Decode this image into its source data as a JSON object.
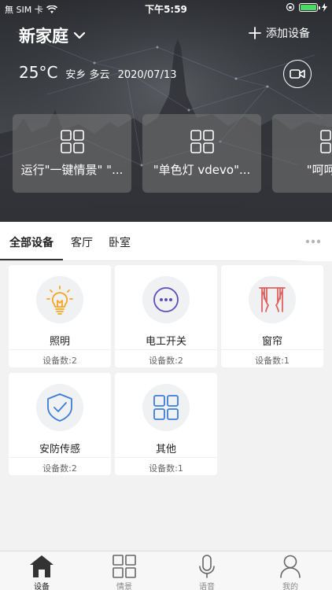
{
  "status_bar": {
    "carrier": "無 SIM 卡",
    "time": "下午5:59"
  },
  "header": {
    "home_name": "新家庭",
    "add_device_label": "添加设备"
  },
  "weather": {
    "temperature": "25°C",
    "location_condition": "安乡 多云",
    "date": "2020/07/13"
  },
  "scenes": [
    {
      "label": "运行\"一键情景\" \"..."
    },
    {
      "label": "\"单色灯 vdevo\"..."
    },
    {
      "label": "\"呵呵\" 开"
    }
  ],
  "tabs": [
    {
      "label": "全部设备",
      "active": true
    },
    {
      "label": "客厅",
      "active": false
    },
    {
      "label": "卧室",
      "active": false
    }
  ],
  "devices": [
    {
      "name": "照明",
      "count": "设备数:2",
      "icon": "bulb-icon",
      "color": "#f5a623"
    },
    {
      "name": "电工开关",
      "count": "设备数:2",
      "icon": "switch-icon",
      "color": "#5b4dbf"
    },
    {
      "name": "窗帘",
      "count": "设备数:1",
      "icon": "curtain-icon",
      "color": "#e0615f"
    },
    {
      "name": "安防传感",
      "count": "设备数:2",
      "icon": "shield-icon",
      "color": "#3b7dd8"
    },
    {
      "name": "其他",
      "count": "设备数:1",
      "icon": "grid-icon",
      "color": "#3b7dd8"
    }
  ],
  "bottom_nav": [
    {
      "label": "设备",
      "icon": "home-icon",
      "active": true
    },
    {
      "label": "情景",
      "icon": "grid-icon",
      "active": false
    },
    {
      "label": "语音",
      "icon": "microphone-icon",
      "active": false
    },
    {
      "label": "我的",
      "icon": "user-icon",
      "active": false
    }
  ]
}
